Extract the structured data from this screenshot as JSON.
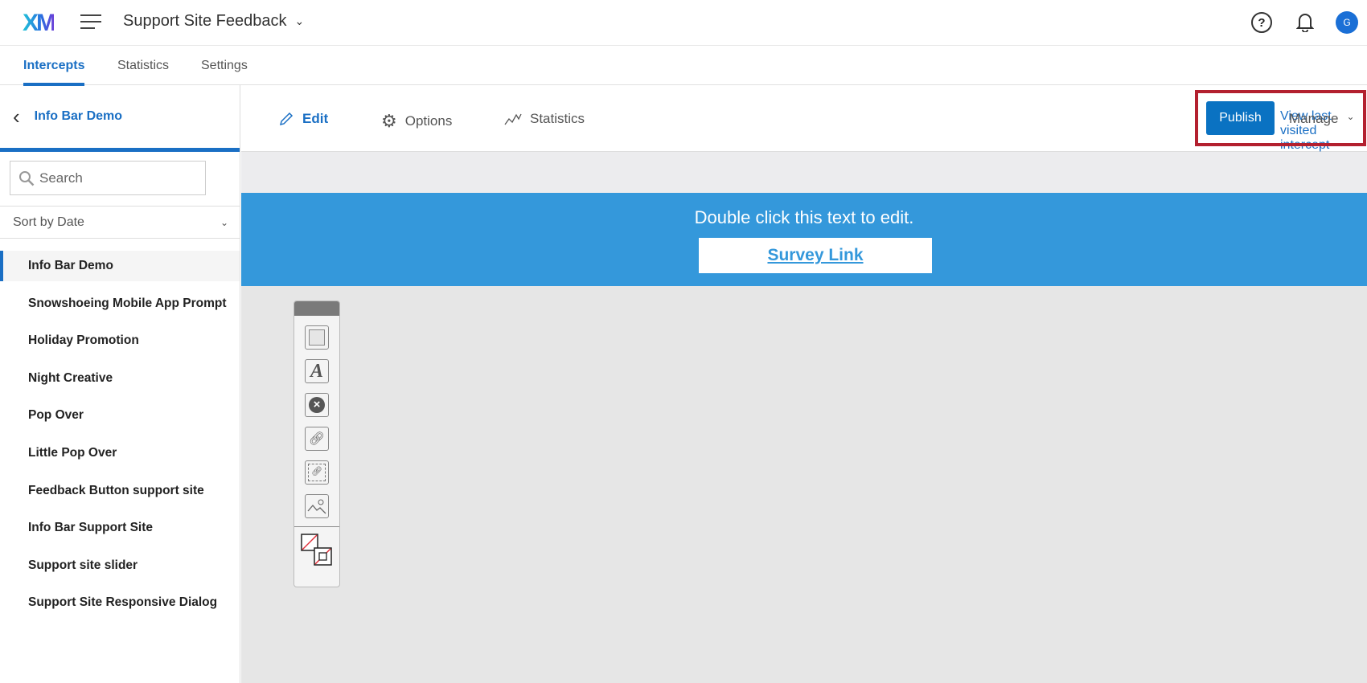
{
  "header": {
    "logo": "XM",
    "project": "Support Site Feedback",
    "avatar": "G"
  },
  "tabs": [
    "Intercepts",
    "Statistics",
    "Settings"
  ],
  "sidebar": {
    "back_title": "Info Bar Demo",
    "search_placeholder": "Search",
    "sort": "Sort by Date",
    "items": [
      "Info Bar Demo",
      "Snowshoeing Mobile App Prompt",
      "Holiday Promotion",
      "Night Creative",
      "Pop Over",
      "Little Pop Over",
      "Feedback Button support site",
      "Info Bar Support Site",
      "Support site slider",
      "Support Site Responsive Dialog"
    ]
  },
  "toolbar": {
    "edit": "Edit",
    "options": "Options",
    "statistics": "Statistics",
    "view_last": "View last visited intercept",
    "publish": "Publish",
    "manage": "Manage"
  },
  "canvas": {
    "info_text": "Double click this text to edit.",
    "link_text": "Survey Link"
  },
  "colors": {
    "accent": "#1a6fc4",
    "infobar": "#3498db",
    "highlight": "#b3202f"
  }
}
